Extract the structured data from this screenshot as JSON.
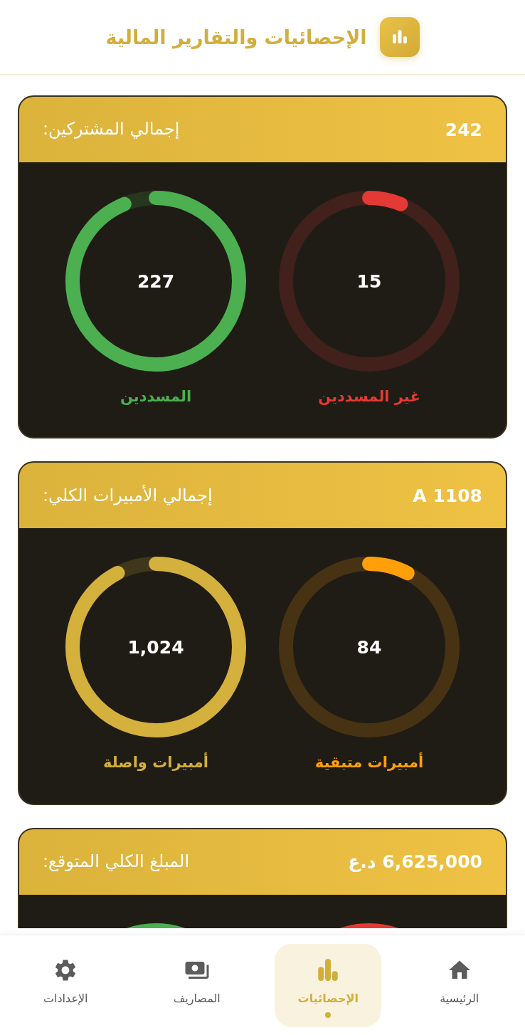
{
  "header": {
    "title": "الإحصائيات والتقارير المالية"
  },
  "cards": [
    {
      "label": "إجمالي المشتركين:",
      "total": "242",
      "rings": [
        {
          "value": "15",
          "label": "غير المسددين",
          "color": "#e53935",
          "level": 0.062
        },
        {
          "value": "227",
          "label": "المسددين",
          "color": "#4caf50",
          "level": 0.938
        }
      ]
    },
    {
      "label": "إجمالي الأمبيرات الكلي:",
      "total": "A 1108",
      "rings": [
        {
          "value": "84",
          "label": "أمبيرات متبقية",
          "color": "#ffa00a",
          "level": 0.076
        },
        {
          "value": "1,024",
          "label": "أمبيرات واصلة",
          "color": "#d4b03c",
          "level": 0.924
        }
      ]
    },
    {
      "label": "المبلغ الكلي المتوقع:",
      "total": "6,625,000 د.ع",
      "rings": [
        {
          "color": "#e53935"
        },
        {
          "color": "#4caf50"
        }
      ]
    }
  ],
  "nav": [
    {
      "label": "الرئيسية",
      "selected": false
    },
    {
      "label": "الإحصائيات",
      "selected": true
    },
    {
      "label": "المصاريف",
      "selected": false
    },
    {
      "label": "الإعدادات",
      "selected": false
    }
  ]
}
